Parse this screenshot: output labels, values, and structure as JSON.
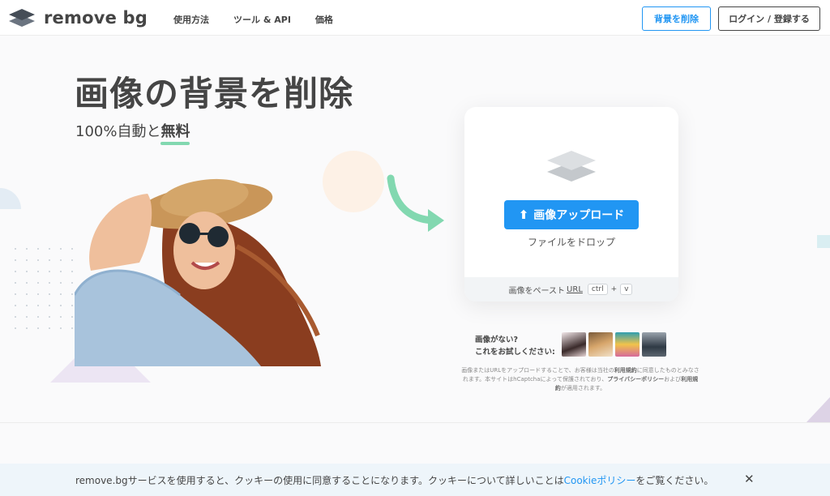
{
  "header": {
    "logo_text": "remove bg",
    "nav": [
      "使用方法",
      "ツール & API",
      "価格"
    ],
    "remove_bg_button": "背景を削除",
    "login_button": "ログイン / 登録する"
  },
  "hero": {
    "title": "画像の背景を削除",
    "subtitle_prefix": "100%自動と",
    "subtitle_emphasis": "無料"
  },
  "upload": {
    "button_label": "画像アップロード",
    "drop_text": "ファイルをドロップ",
    "paste_prefix": "画像をペースト",
    "paste_url": "URL",
    "key_ctrl": "ctrl",
    "key_plus": "+",
    "key_v": "v"
  },
  "samples": {
    "line1": "画像がない?",
    "line2": "これをお試しください:"
  },
  "legal": {
    "part1": "画像またはURLをアップロードすることで、お客様は当社の",
    "terms1": "利用規約",
    "part2": "に同意したものとみなされます。本サイトはhCaptchaによって保護されており、",
    "privacy": "プライバシーポリシー",
    "part3": "および",
    "terms2": "利用規約",
    "part4": "が適用されます。"
  },
  "cookie": {
    "text": "remove.bgサービスを使用すると、クッキーの使用に同意することになります。クッキーについて詳しいことは",
    "link": "Cookieポリシー",
    "suffix": "をご覧ください。",
    "close": "✕"
  },
  "colors": {
    "accent": "#2196f3",
    "text": "#454545",
    "highlight": "#82d8b0"
  }
}
